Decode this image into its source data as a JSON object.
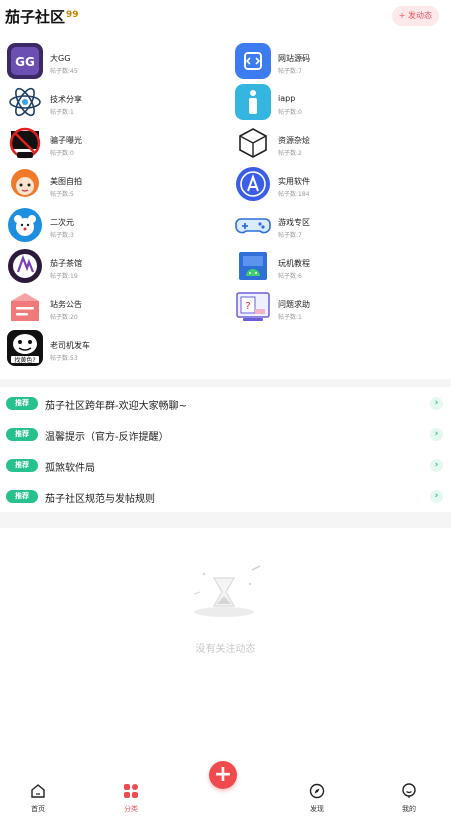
{
  "header": {
    "title": "茄子社区",
    "badge": "99",
    "post_button": "+ 发动态"
  },
  "categories": [
    {
      "name": "大GG",
      "count": "帖子数:45",
      "icon": "game-guardian-icon"
    },
    {
      "name": "网站源码",
      "count": "帖子数:7",
      "icon": "code-icon"
    },
    {
      "name": "技术分享",
      "count": "帖子数:1",
      "icon": "atom-icon"
    },
    {
      "name": "iapp",
      "count": "帖子数:0",
      "icon": "iapp-icon"
    },
    {
      "name": "骗子曝光",
      "count": "帖子数:0",
      "icon": "anti-fraud-icon"
    },
    {
      "name": "资源杂烩",
      "count": "帖子数:2",
      "icon": "cube-icon"
    },
    {
      "name": "美图自拍",
      "count": "帖子数:5",
      "icon": "anime-girl-icon"
    },
    {
      "name": "实用软件",
      "count": "帖子数:184",
      "icon": "app-store-icon"
    },
    {
      "name": "二次元",
      "count": "帖子数:3",
      "icon": "bear-icon"
    },
    {
      "name": "游戏专区",
      "count": "帖子数:7",
      "icon": "gamepad-icon"
    },
    {
      "name": "茄子茶馆",
      "count": "帖子数:19",
      "icon": "tea-house-icon"
    },
    {
      "name": "玩机教程",
      "count": "帖子数:6",
      "icon": "android-icon"
    },
    {
      "name": "站务公告",
      "count": "帖子数:20",
      "icon": "notice-icon"
    },
    {
      "name": "问题求助",
      "count": "帖子数:1",
      "icon": "help-icon"
    },
    {
      "name": "老司机发车",
      "count": "帖子数:53",
      "icon": "meme-face-icon"
    }
  ],
  "recommend": {
    "tag": "推荐",
    "items": [
      {
        "title": "茄子社区跨年群-欢迎大家畅聊~"
      },
      {
        "title": "温馨提示（官方-反诈提醒）"
      },
      {
        "title": "孤煞软件局"
      },
      {
        "title": "茄子社区规范与发帖规则"
      }
    ]
  },
  "empty_state": {
    "text": "没有关注动态"
  },
  "tabbar": {
    "tabs": [
      {
        "label": "首页",
        "icon": "home-icon"
      },
      {
        "label": "分类",
        "icon": "category-icon"
      },
      {
        "label": "发现",
        "icon": "compass-icon"
      },
      {
        "label": "我的",
        "icon": "profile-icon"
      }
    ],
    "active": "分类",
    "fab": "+"
  },
  "colors": {
    "accent": "#f04a4f",
    "recommend_green": "#27c08f",
    "count_gray": "#999999"
  }
}
